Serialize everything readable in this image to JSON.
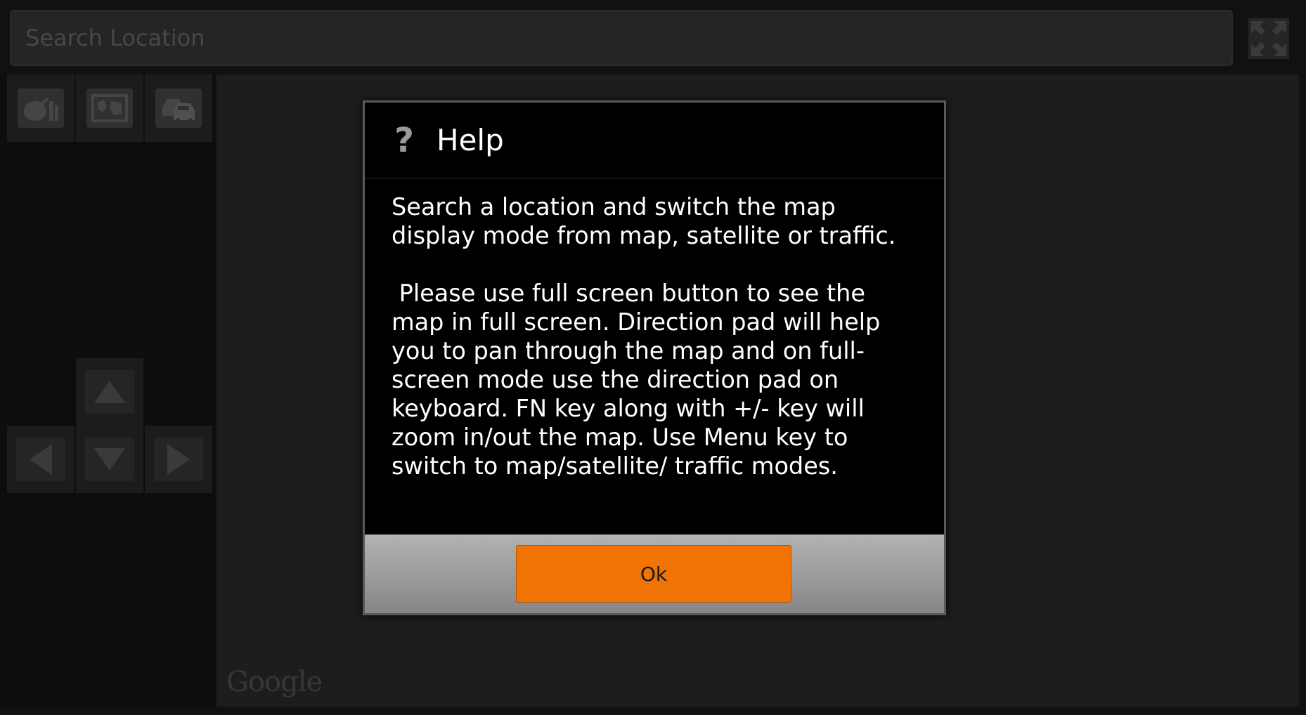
{
  "search": {
    "placeholder": "Search Location",
    "value": ""
  },
  "toolbar": {
    "fullscreen_icon": "fullscreen-expand-icon"
  },
  "modes": [
    {
      "name": "satellite",
      "icon": "satellite-dish-icon"
    },
    {
      "name": "map",
      "icon": "map-icon"
    },
    {
      "name": "traffic",
      "icon": "traffic-cars-icon"
    }
  ],
  "map": {
    "attribution": "Google"
  },
  "dialog": {
    "icon": "?",
    "title": "Help",
    "paragraph1": "Search a location and switch the map display mode from map, satellite or traffic.",
    "paragraph2": " Please use full screen button to see the map in full screen. Direction pad will help you to pan through the map and on full-screen mode use the direction pad on keyboard. FN key along with +/- key will zoom in/out the map. Use Menu key to switch to map/satellite/ traffic modes.",
    "ok_label": "Ok"
  },
  "colors": {
    "accent": "#ef7305",
    "dialog_bg": "#000000",
    "footer_gradient_top": "#b3b3b3",
    "footer_gradient_bottom": "#868686"
  }
}
